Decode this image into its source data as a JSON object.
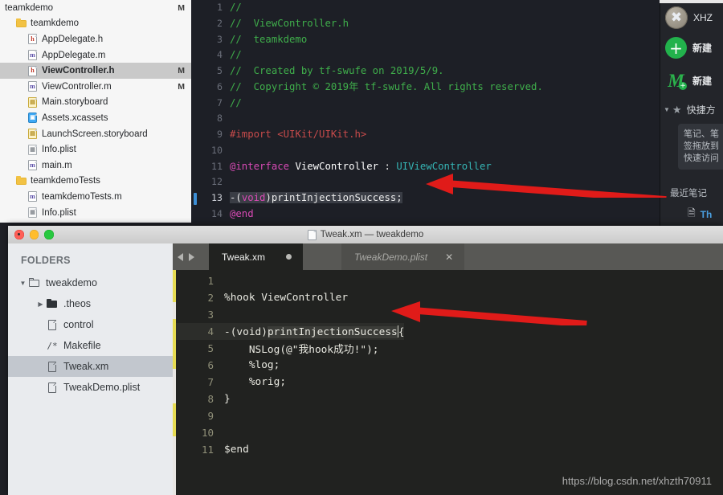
{
  "xcode": {
    "navigator": {
      "rows": [
        {
          "label": "teamkdemo",
          "badge": "M",
          "icon": "project-icon",
          "indent": 0,
          "selected": false,
          "kind": "project"
        },
        {
          "label": "teamkdemo",
          "badge": "",
          "icon": "folder-icon",
          "indent": 1,
          "selected": false,
          "kind": "folder"
        },
        {
          "label": "AppDelegate.h",
          "badge": "",
          "icon": "header-file-icon",
          "indent": 2,
          "selected": false,
          "kind": "h"
        },
        {
          "label": "AppDelegate.m",
          "badge": "",
          "icon": "objc-file-icon",
          "indent": 2,
          "selected": false,
          "kind": "m"
        },
        {
          "label": "ViewController.h",
          "badge": "M",
          "icon": "header-file-icon",
          "indent": 2,
          "selected": true,
          "kind": "h"
        },
        {
          "label": "ViewController.m",
          "badge": "M",
          "icon": "objc-file-icon",
          "indent": 2,
          "selected": false,
          "kind": "m"
        },
        {
          "label": "Main.storyboard",
          "badge": "",
          "icon": "storyboard-icon",
          "indent": 2,
          "selected": false,
          "kind": "sb"
        },
        {
          "label": "Assets.xcassets",
          "badge": "",
          "icon": "xcassets-icon",
          "indent": 2,
          "selected": false,
          "kind": "xc"
        },
        {
          "label": "LaunchScreen.storyboard",
          "badge": "",
          "icon": "storyboard-icon",
          "indent": 2,
          "selected": false,
          "kind": "sb"
        },
        {
          "label": "Info.plist",
          "badge": "",
          "icon": "plist-icon",
          "indent": 2,
          "selected": false,
          "kind": "pl"
        },
        {
          "label": "main.m",
          "badge": "",
          "icon": "objc-file-icon",
          "indent": 2,
          "selected": false,
          "kind": "m"
        },
        {
          "label": "teamkdemoTests",
          "badge": "",
          "icon": "folder-icon",
          "indent": 1,
          "selected": false,
          "kind": "folder"
        },
        {
          "label": "teamkdemoTests.m",
          "badge": "",
          "icon": "objc-file-icon",
          "indent": 2,
          "selected": false,
          "kind": "m"
        },
        {
          "label": "Info.plist",
          "badge": "",
          "icon": "plist-icon",
          "indent": 2,
          "selected": false,
          "kind": "pl"
        }
      ]
    },
    "editor": {
      "filename": "ViewController.h",
      "current_line": 13,
      "lines": [
        {
          "n": "1",
          "segs": [
            {
              "t": "//",
              "c": "c-com"
            }
          ]
        },
        {
          "n": "2",
          "segs": [
            {
              "t": "//  ViewController.h",
              "c": "c-com"
            }
          ]
        },
        {
          "n": "3",
          "segs": [
            {
              "t": "//  teamkdemo",
              "c": "c-com"
            }
          ]
        },
        {
          "n": "4",
          "segs": [
            {
              "t": "//",
              "c": "c-com"
            }
          ]
        },
        {
          "n": "5",
          "segs": [
            {
              "t": "//  Created by tf-swufe on 2019/5/9.",
              "c": "c-com"
            }
          ]
        },
        {
          "n": "6",
          "segs": [
            {
              "t": "//  Copyright © 2019年 tf-swufe. All rights reserved.",
              "c": "c-com"
            }
          ]
        },
        {
          "n": "7",
          "segs": [
            {
              "t": "//",
              "c": "c-com"
            }
          ]
        },
        {
          "n": "8",
          "segs": []
        },
        {
          "n": "9",
          "segs": [
            {
              "t": "#import ",
              "c": "c-pre"
            },
            {
              "t": "<UIKit/UIKit.h>",
              "c": "c-pre"
            }
          ]
        },
        {
          "n": "10",
          "segs": []
        },
        {
          "n": "11",
          "segs": [
            {
              "t": "@interface ",
              "c": "c-kw"
            },
            {
              "t": "ViewController",
              "c": "c-white"
            },
            {
              "t": " : ",
              "c": "c-plain"
            },
            {
              "t": "UIViewController",
              "c": "c-type"
            }
          ]
        },
        {
          "n": "12",
          "segs": []
        },
        {
          "n": "13",
          "segs": [
            {
              "t": "-(",
              "c": "c-plain",
              "sel": true
            },
            {
              "t": "void",
              "c": "c-kw",
              "sel": true
            },
            {
              "t": ")printInjectionSuccess;",
              "c": "c-plain",
              "sel": true
            }
          ]
        },
        {
          "n": "14",
          "segs": [
            {
              "t": "@end",
              "c": "c-kw"
            }
          ]
        }
      ]
    }
  },
  "evernote": {
    "account_name": "XHZ",
    "avatar_glyph": "✖",
    "new_note_label": "新建",
    "new_markdown_label": "新建",
    "quick_access_label": "快捷方",
    "hint_lines": [
      "笔记、笔",
      "签拖放到",
      "快速访问"
    ],
    "recent_heading": "最近笔记",
    "recent_item": "Th"
  },
  "sublime": {
    "window_title": "Tweak.xm — tweakdemo",
    "sidebar": {
      "heading": "FOLDERS",
      "rows": [
        {
          "label": "tweakdemo",
          "caret": "▼",
          "icon": "folder-open-icon",
          "indent": 0,
          "selected": false
        },
        {
          "label": ".theos",
          "caret": "▶",
          "icon": "folder-solid-icon",
          "indent": 1,
          "selected": false
        },
        {
          "label": "control",
          "caret": "",
          "icon": "file-icon",
          "indent": 1,
          "selected": false
        },
        {
          "label": "Makefile",
          "caret": "",
          "icon": "makefile-icon",
          "indent": 1,
          "selected": false
        },
        {
          "label": "Tweak.xm",
          "caret": "",
          "icon": "file-icon",
          "indent": 1,
          "selected": true
        },
        {
          "label": "TweakDemo.plist",
          "caret": "",
          "icon": "file-icon",
          "indent": 1,
          "selected": false
        }
      ]
    },
    "tabs": [
      {
        "label": "Tweak.xm",
        "active": true,
        "dirty": true
      },
      {
        "label": "TweakDemo.plist",
        "active": false,
        "dirty": false
      }
    ],
    "editor": {
      "current_line": 4,
      "lines": [
        {
          "n": "1",
          "text": ""
        },
        {
          "n": "2",
          "text": "%hook ViewController"
        },
        {
          "n": "3",
          "text": ""
        },
        {
          "n": "4",
          "text": "-(void)printInjectionSuccess{",
          "sel_from": 7,
          "sel_to": 28,
          "caret": true
        },
        {
          "n": "5",
          "text": "    NSLog(@\"我hook成功!\");"
        },
        {
          "n": "6",
          "text": "    %log;"
        },
        {
          "n": "7",
          "text": "    %orig;"
        },
        {
          "n": "8",
          "text": "}"
        },
        {
          "n": "9",
          "text": ""
        },
        {
          "n": "10",
          "text": ""
        },
        {
          "n": "11",
          "text": "$end"
        }
      ]
    }
  },
  "annotations": {
    "arrow_color": "#e01b19",
    "arrow_count": 2
  },
  "watermark": "https://blog.csdn.net/xhzth70911"
}
